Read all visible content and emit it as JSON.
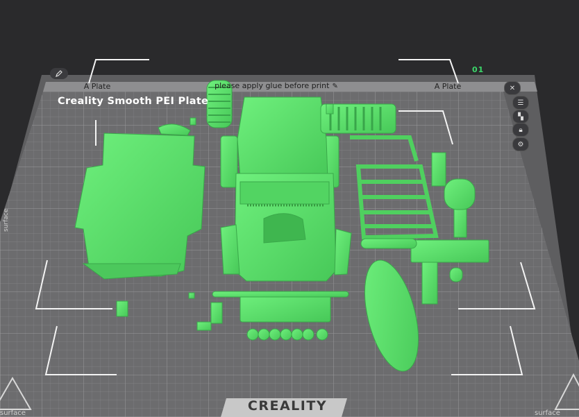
{
  "plate": {
    "left_tab": "A Plate",
    "right_tab": "A Plate",
    "note": "please apply glue before print",
    "title": "Creality Smooth PEI Plate",
    "index": "01",
    "brand": "CREALITY",
    "left_side_label": "surface",
    "bottom_left_label": "surface",
    "bottom_right_label": "surface"
  },
  "side_buttons": [
    {
      "icon": "list-icon"
    },
    {
      "icon": "auto-arrange-icon"
    },
    {
      "icon": "lock-icon"
    },
    {
      "icon": "gear-icon"
    }
  ],
  "colors": {
    "background": "#2a2a2c",
    "plate_surface": "#6c6c6e",
    "grid_line": "#8a8a8c",
    "model": "#5fe36f",
    "model_shade": "#3fb64f",
    "accent_index": "#3bd86a"
  }
}
